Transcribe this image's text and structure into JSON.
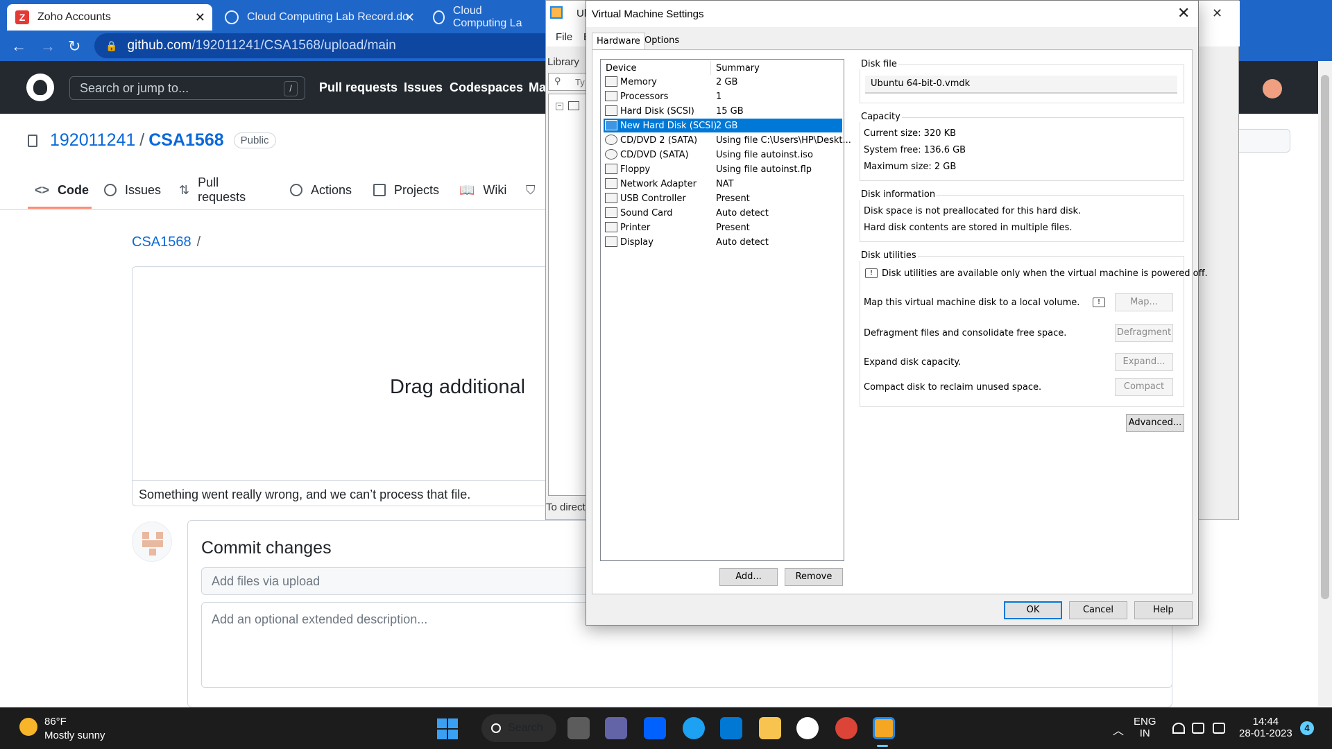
{
  "browser": {
    "tabs": [
      {
        "title": "Zoho Accounts",
        "icon": "zoho-z-icon",
        "active": true
      },
      {
        "title": "Cloud Computing Lab Record.do",
        "icon": "web-icon",
        "active": false
      },
      {
        "title": "Cloud Computing La",
        "icon": "web-icon",
        "active": false
      }
    ],
    "url": {
      "host": "github.com",
      "path": "/192011241/CSA1568/upload/main"
    }
  },
  "github": {
    "search_placeholder": "Search or jump to...",
    "search_shortcut": "/",
    "nav": [
      "Pull requests",
      "Issues",
      "Codespaces",
      "Ma"
    ],
    "repo_owner": "192011241",
    "repo_sep": "/",
    "repo_name": "CSA1568",
    "visibility": "Public",
    "tabs": [
      "Code",
      "Issues",
      "Pull requests",
      "Actions",
      "Projects",
      "Wiki"
    ],
    "breadcrumb": "CSA1568",
    "breadcrumb_sep": "/",
    "drop_text": "Drag additional",
    "error_text": "Something went really wrong, and we can’t process that file.",
    "commit_title": "Commit changes",
    "commit_placeholder": "Add files via upload",
    "desc_placeholder": "Add an optional extended description..."
  },
  "vmware": {
    "title": "Ul",
    "menu": [
      "File",
      "E"
    ],
    "library_label": "Library",
    "search_text": "Ty",
    "status_text": "To direct"
  },
  "dialog": {
    "title": "Virtual Machine Settings",
    "tabs": [
      "Hardware",
      "Options"
    ],
    "device_header": "Device",
    "summary_header": "Summary",
    "devices": [
      {
        "name": "Memory",
        "summary": "2 GB",
        "icon": "memory-icon",
        "selected": false
      },
      {
        "name": "Processors",
        "summary": "1",
        "icon": "processor-icon",
        "selected": false
      },
      {
        "name": "Hard Disk (SCSI)",
        "summary": "15 GB",
        "icon": "hard-disk-icon",
        "selected": false
      },
      {
        "name": "New Hard Disk (SCSI)",
        "summary": "2 GB",
        "icon": "hard-disk-icon",
        "selected": true
      },
      {
        "name": "CD/DVD 2 (SATA)",
        "summary": "Using file C:\\Users\\HP\\Deskt...",
        "icon": "cd-icon",
        "selected": false
      },
      {
        "name": "CD/DVD (SATA)",
        "summary": "Using file autoinst.iso",
        "icon": "cd-icon",
        "selected": false
      },
      {
        "name": "Floppy",
        "summary": "Using file autoinst.flp",
        "icon": "floppy-icon",
        "selected": false
      },
      {
        "name": "Network Adapter",
        "summary": "NAT",
        "icon": "network-icon",
        "selected": false
      },
      {
        "name": "USB Controller",
        "summary": "Present",
        "icon": "usb-icon",
        "selected": false
      },
      {
        "name": "Sound Card",
        "summary": "Auto detect",
        "icon": "sound-icon",
        "selected": false
      },
      {
        "name": "Printer",
        "summary": "Present",
        "icon": "printer-icon",
        "selected": false
      },
      {
        "name": "Display",
        "summary": "Auto detect",
        "icon": "display-icon",
        "selected": false
      }
    ],
    "add_label": "Add...",
    "remove_label": "Remove",
    "disk_file_label": "Disk file",
    "disk_file_value": "Ubuntu 64-bit-0.vmdk",
    "capacity_label": "Capacity",
    "current_size": "Current size:  320 KB",
    "system_free": "System free:  136.6 GB",
    "maximum_size": "Maximum size:  2 GB",
    "disk_info_label": "Disk information",
    "disk_info_1": "Disk space is not preallocated for this hard disk.",
    "disk_info_2": "Hard disk contents are stored in multiple files.",
    "utilities_label": "Disk utilities",
    "utilities_note": "Disk utilities are available only when the virtual machine is powered off.",
    "map_text": "Map this virtual machine disk to a local volume.",
    "map_btn": "Map...",
    "defrag_text": "Defragment files and consolidate free space.",
    "defrag_btn": "Defragment",
    "expand_text": "Expand disk capacity.",
    "expand_btn": "Expand...",
    "compact_text": "Compact disk to reclaim unused space.",
    "compact_btn": "Compact",
    "advanced_btn": "Advanced...",
    "ok_btn": "OK",
    "cancel_btn": "Cancel",
    "help_btn": "Help"
  },
  "taskbar": {
    "temperature": "86°F",
    "weather": "Mostly sunny",
    "search_label": "Search",
    "lang_1": "ENG",
    "lang_2": "IN",
    "time": "14:44",
    "date": "28-01-2023",
    "notifications": "4"
  }
}
